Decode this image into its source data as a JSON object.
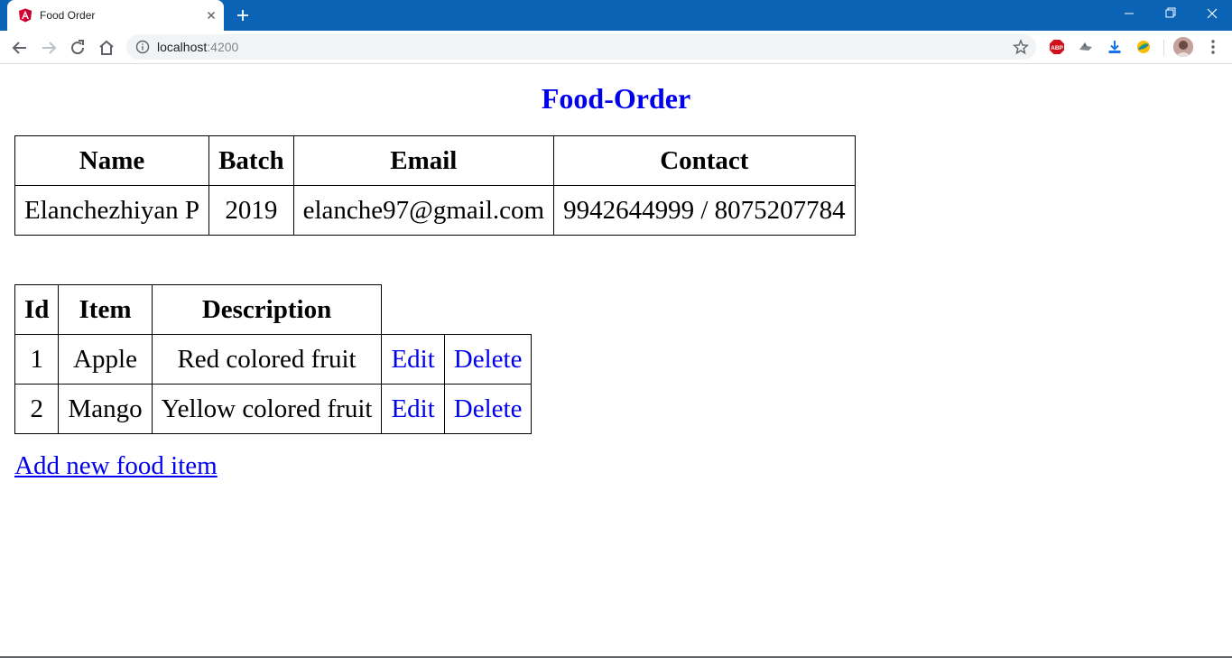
{
  "browser": {
    "tab_title": "Food Order",
    "url_host": "localhost",
    "url_port": ":4200"
  },
  "page": {
    "heading": "Food-Order",
    "student_table": {
      "headers": [
        "Name",
        "Batch",
        "Email",
        "Contact"
      ],
      "row": {
        "name": "Elanchezhiyan P",
        "batch": "2019",
        "email": "elanche97@gmail.com",
        "contact": "9942644999 / 8075207784"
      }
    },
    "food_table": {
      "headers": [
        "Id",
        "Item",
        "Description"
      ],
      "rows": [
        {
          "id": "1",
          "item": "Apple",
          "description": "Red colored fruit",
          "edit": "Edit",
          "delete": "Delete"
        },
        {
          "id": "2",
          "item": "Mango",
          "description": "Yellow colored fruit",
          "edit": "Edit",
          "delete": "Delete"
        }
      ]
    },
    "add_link": "Add new food item"
  },
  "colors": {
    "chrome_blue": "#0a63b4",
    "link_blue": "#0000ee",
    "angular_red": "#dd0031"
  }
}
